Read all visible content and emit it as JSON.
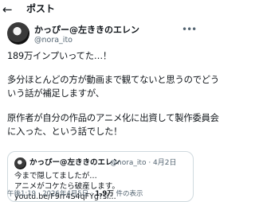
{
  "header": {
    "back_icon": "arrow-left-icon",
    "title": "ポスト"
  },
  "author": {
    "display_name": "かっぴー@左ききのエレン",
    "handle": "@nora_ito",
    "avatar": "avatar-portrait"
  },
  "tweet": {
    "lines": [
      "189万インプいってた…！",
      "多分ほとんどの方が動画まで観てないと思うのでどう",
      "いう話が補足しますが、",
      "原作者が自分の作品のアニメ化に出資して製作委員会",
      "に入った、という話でした！"
    ]
  },
  "quote": {
    "display_name": "かっぴー@左ききのエレン",
    "meta": "@nora_ito · 4月2日",
    "lines": [
      "今まで隠してましたが…",
      "アニメがコケたら破産します。",
      "youtu.be/F9rr4S4qFYg?si..."
    ]
  },
  "footer": {
    "timestamp": "午後1:19 · 2026年4月5日 · ",
    "views_count": "1.9万",
    "views_label": " 件の表示"
  }
}
